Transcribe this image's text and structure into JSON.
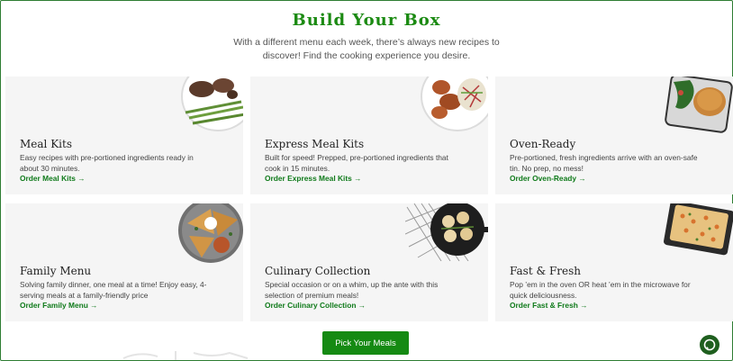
{
  "header": {
    "title": "Build Your Box",
    "subtitle": "With a different menu each week, there’s always new recipes to discover! Find the cooking experience you desire."
  },
  "cards": [
    {
      "name": "Meal Kits",
      "desc": "Easy recipes with pre-portioned ingredients ready in about 30 minutes.",
      "link": "Order Meal Kits →",
      "icon": "steak-plate-icon"
    },
    {
      "name": "Express Meal Kits",
      "desc": "Built for speed! Prepped, pre-portioned ingredients that cook in 15 minutes.",
      "link": "Order Express Meal Kits →",
      "icon": "chicken-plate-icon"
    },
    {
      "name": "Oven-Ready",
      "desc": "Pre-portioned, fresh ingredients arrive with an oven-safe tin. No prep, no mess!",
      "link": "Order Oven-Ready →",
      "icon": "oven-tray-icon"
    },
    {
      "name": "Family Menu",
      "desc": "Solving family dinner, one meal at a time! Enjoy easy, 4-serving meals at a family-friendly price",
      "link": "Order Family Menu →",
      "icon": "quesadilla-pan-icon"
    },
    {
      "name": "Culinary Collection",
      "desc": "Special occasion or on a whim, up the ante with this selection of premium meals!",
      "link": "Order Culinary Collection →",
      "icon": "scallops-skillet-icon"
    },
    {
      "name": "Fast & Fresh",
      "desc": "Pop ’em in the oven OR heat ’em in the microwave for quick deliciousness.",
      "link": "Order Fast & Fresh →",
      "icon": "pasta-tray-icon"
    }
  ],
  "cta": {
    "label": "Pick Your Meals"
  },
  "chat": {
    "icon": "chat-bubble-icon"
  },
  "colors": {
    "brand": "#1b8a12",
    "cta": "#158a13",
    "card_bg": "#f5f5f5",
    "chat": "#1f5f1f"
  }
}
